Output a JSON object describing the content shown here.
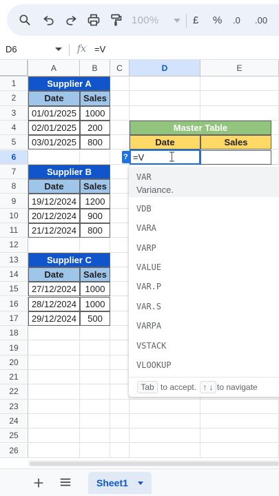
{
  "toolbar": {
    "zoom": "100%",
    "currency": "£",
    "percent": "%",
    "decrease_decimal": ".0",
    "increase_decimal": ".00"
  },
  "formula_bar": {
    "name_box": "D6",
    "fx": "fx",
    "value": "=V"
  },
  "columns": [
    "A",
    "B",
    "C",
    "D",
    "E"
  ],
  "rows": [
    "1",
    "2",
    "3",
    "4",
    "5",
    "6",
    "7",
    "8",
    "9",
    "10",
    "11",
    "12",
    "13",
    "14",
    "15",
    "16",
    "17",
    "18",
    "19",
    "20",
    "21",
    "22",
    "23",
    "24",
    "25",
    "26"
  ],
  "supplier_a": {
    "title": "Supplier A",
    "headers": [
      "Date",
      "Sales"
    ],
    "rows": [
      [
        "01/01/2025",
        "1000"
      ],
      [
        "02/01/2025",
        "200"
      ],
      [
        "03/01/2025",
        "800"
      ]
    ]
  },
  "supplier_b": {
    "title": "Supplier B",
    "headers": [
      "Date",
      "Sales"
    ],
    "rows": [
      [
        "19/12/2024",
        "1200"
      ],
      [
        "20/12/2024",
        "900"
      ],
      [
        "21/12/2024",
        "800"
      ]
    ]
  },
  "supplier_c": {
    "title": "Supplier C",
    "headers": [
      "Date",
      "Sales"
    ],
    "rows": [
      [
        "27/12/2024",
        "1000"
      ],
      [
        "28/12/2024",
        "1000"
      ],
      [
        "29/12/2024",
        "500"
      ]
    ]
  },
  "master": {
    "title": "Master Table",
    "headers": [
      "Date",
      "Sales"
    ]
  },
  "active_cell": {
    "badge": "?",
    "value": "=V"
  },
  "autocomplete": {
    "items": [
      {
        "name": "VAR",
        "desc": "Variance."
      },
      {
        "name": "VDB"
      },
      {
        "name": "VARA"
      },
      {
        "name": "VARP"
      },
      {
        "name": "VALUE"
      },
      {
        "name": "VAR.P"
      },
      {
        "name": "VAR.S"
      },
      {
        "name": "VARPA"
      },
      {
        "name": "VSTACK"
      },
      {
        "name": "VLOOKUP"
      }
    ],
    "footer": {
      "tab_key": "Tab",
      "accept_text": "to accept.",
      "nav_keys": "↑ ↓",
      "nav_text": "to navigate"
    }
  },
  "bottom": {
    "sheet_name": "Sheet1"
  },
  "colors": {
    "header_blue": "#1155cc",
    "header_light_blue": "#9fc5e8",
    "master_green": "#93c47d",
    "master_yellow": "#ffd966",
    "selection_blue": "#1a73e8"
  }
}
